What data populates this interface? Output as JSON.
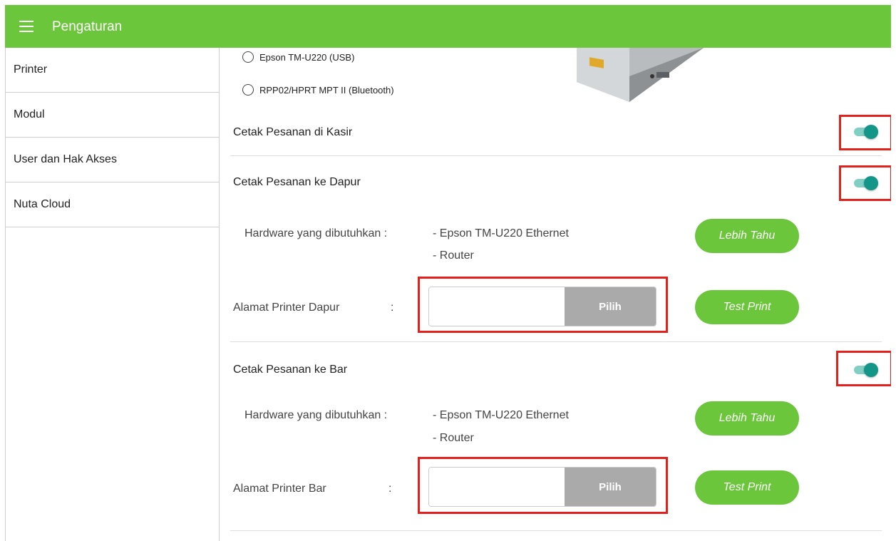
{
  "header": {
    "title": "Pengaturan",
    "menu_icon": "hamburger-icon"
  },
  "sidebar": {
    "items": [
      {
        "label": "Printer"
      },
      {
        "label": "Modul"
      },
      {
        "label": "User dan Hak Akses"
      },
      {
        "label": "Nuta Cloud"
      }
    ]
  },
  "printers": {
    "options": [
      {
        "label": "Epson TM-U220 (USB)"
      },
      {
        "label": "RPP02/HPRT MPT II (Bluetooth)"
      }
    ]
  },
  "kasir": {
    "title": "Cetak Pesanan di Kasir",
    "enabled": true
  },
  "dapur": {
    "title": "Cetak Pesanan ke Dapur",
    "enabled": true,
    "hw_label": "Hardware yang dibutuhkan :",
    "hw_items": [
      "- Epson TM-U220 Ethernet",
      "- Router"
    ],
    "learn_more": "Lebih Tahu",
    "address_label": "Alamat Printer Dapur",
    "colon": ":",
    "address_value": "",
    "pick_label": "Pilih",
    "test_print": "Test Print"
  },
  "bar": {
    "title": "Cetak Pesanan ke Bar",
    "enabled": true,
    "hw_label": "Hardware yang dibutuhkan :",
    "hw_items": [
      "- Epson TM-U220 Ethernet",
      "- Router"
    ],
    "learn_more": "Lebih Tahu",
    "address_label": "Alamat Printer Bar",
    "colon": ":",
    "address_value": "",
    "pick_label": "Pilih",
    "test_print": "Test Print"
  },
  "colors": {
    "accent": "#6bc63b",
    "toggle_on": "#139688",
    "highlight": "#e2201c",
    "pick_button": "#aaaaaa"
  }
}
